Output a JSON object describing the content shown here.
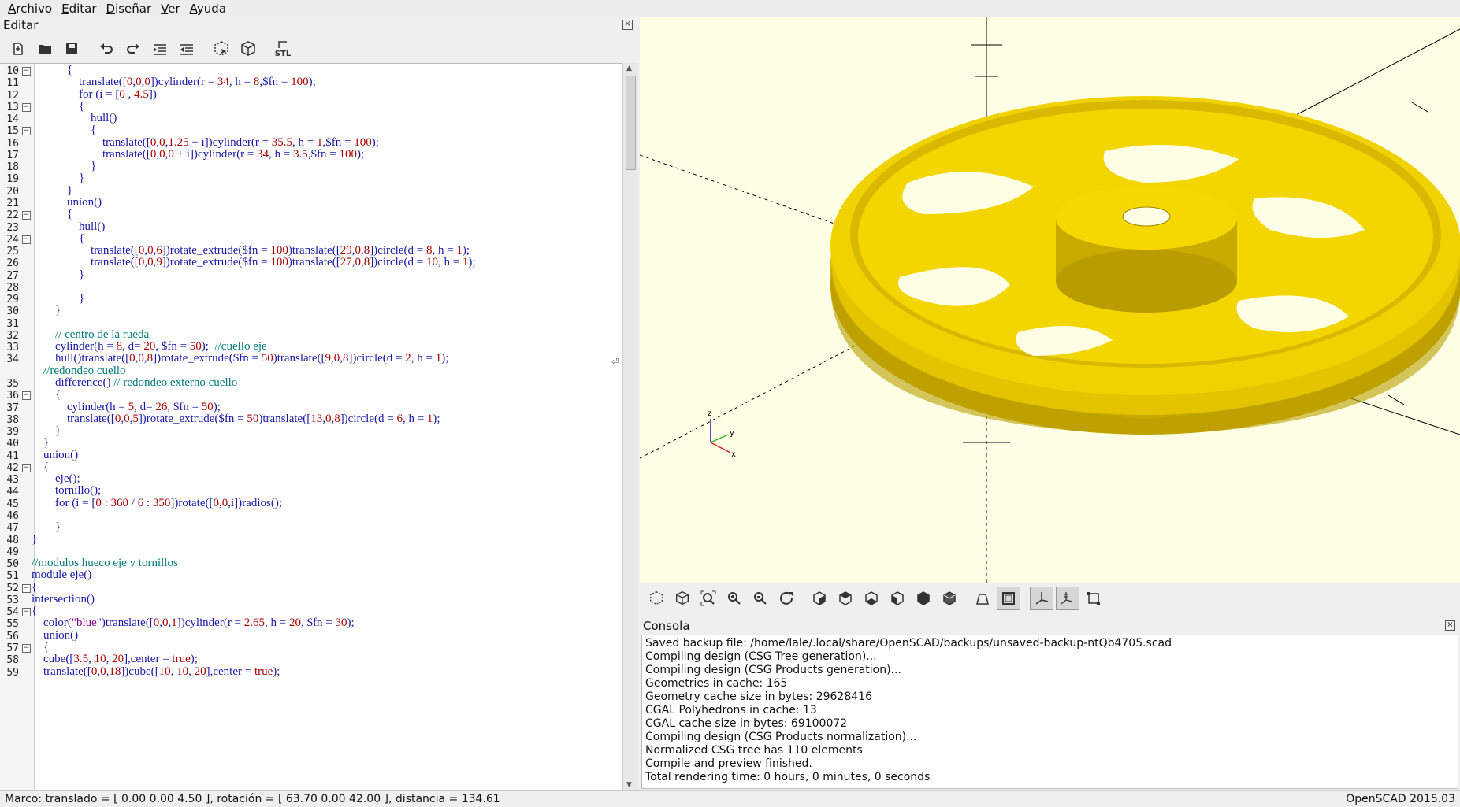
{
  "menu": [
    "Archivo",
    "Editar",
    "Diseñar",
    "Ver",
    "Ayuda"
  ],
  "editor": {
    "title": "Editar",
    "close": "×"
  },
  "editor_toolbar": [
    "new-file-icon",
    "open-file-icon",
    "save-icon",
    "undo-icon",
    "redo-icon",
    "indent-icon",
    "unindent-icon",
    "preview-icon",
    "render-icon",
    "export-stl-icon"
  ],
  "stl_label": "STL",
  "code": [
    {
      "n": "10",
      "f": true,
      "segs": [
        [
          "k",
          "            {"
        ]
      ]
    },
    {
      "n": "11",
      "f": false,
      "segs": [
        [
          "k",
          "                translate(["
        ],
        [
          "n",
          "0"
        ],
        [
          "k",
          ","
        ],
        [
          "n",
          "0"
        ],
        [
          "k",
          ","
        ],
        [
          "n",
          "0"
        ],
        [
          "k",
          "])cylinder(r = "
        ],
        [
          "n",
          "34"
        ],
        [
          "k",
          ", h = "
        ],
        [
          "n",
          "8"
        ],
        [
          "k",
          ",$fn = "
        ],
        [
          "n",
          "100"
        ],
        [
          "k",
          ");"
        ]
      ]
    },
    {
      "n": "12",
      "f": false,
      "segs": [
        [
          "k",
          "                for (i = ["
        ],
        [
          "n",
          "0"
        ],
        [
          "k",
          " , "
        ],
        [
          "n",
          "4.5"
        ],
        [
          "k",
          "])"
        ]
      ]
    },
    {
      "n": "13",
      "f": true,
      "segs": [
        [
          "k",
          "                {"
        ]
      ]
    },
    {
      "n": "14",
      "f": false,
      "segs": [
        [
          "k",
          "                    hull()"
        ]
      ]
    },
    {
      "n": "15",
      "f": true,
      "segs": [
        [
          "k",
          "                    {"
        ]
      ]
    },
    {
      "n": "16",
      "f": false,
      "segs": [
        [
          "k",
          "                        translate(["
        ],
        [
          "n",
          "0"
        ],
        [
          "k",
          ","
        ],
        [
          "n",
          "0"
        ],
        [
          "k",
          ","
        ],
        [
          "n",
          "1.25"
        ],
        [
          "k",
          " + i])cylinder(r = "
        ],
        [
          "n",
          "35.5"
        ],
        [
          "k",
          ", h = "
        ],
        [
          "n",
          "1"
        ],
        [
          "k",
          ",$fn = "
        ],
        [
          "n",
          "100"
        ],
        [
          "k",
          ");"
        ]
      ]
    },
    {
      "n": "17",
      "f": false,
      "segs": [
        [
          "k",
          "                        translate(["
        ],
        [
          "n",
          "0"
        ],
        [
          "k",
          ","
        ],
        [
          "n",
          "0"
        ],
        [
          "k",
          ","
        ],
        [
          "n",
          "0"
        ],
        [
          "k",
          " + i])cylinder(r = "
        ],
        [
          "n",
          "34"
        ],
        [
          "k",
          ", h = "
        ],
        [
          "n",
          "3.5"
        ],
        [
          "k",
          ",$fn = "
        ],
        [
          "n",
          "100"
        ],
        [
          "k",
          ");"
        ]
      ]
    },
    {
      "n": "18",
      "f": false,
      "segs": [
        [
          "k",
          "                    }"
        ]
      ]
    },
    {
      "n": "19",
      "f": false,
      "segs": [
        [
          "k",
          "                }"
        ]
      ]
    },
    {
      "n": "20",
      "f": false,
      "segs": [
        [
          "k",
          "            }"
        ]
      ]
    },
    {
      "n": "21",
      "f": false,
      "segs": [
        [
          "k",
          "            union()"
        ]
      ]
    },
    {
      "n": "22",
      "f": true,
      "segs": [
        [
          "k",
          "            {"
        ]
      ]
    },
    {
      "n": "23",
      "f": false,
      "segs": [
        [
          "k",
          "                hull()"
        ]
      ]
    },
    {
      "n": "24",
      "f": true,
      "segs": [
        [
          "k",
          "                {"
        ]
      ]
    },
    {
      "n": "25",
      "f": false,
      "segs": [
        [
          "k",
          "                    translate(["
        ],
        [
          "n",
          "0"
        ],
        [
          "k",
          ","
        ],
        [
          "n",
          "0"
        ],
        [
          "k",
          ","
        ],
        [
          "n",
          "6"
        ],
        [
          "k",
          "])rotate_extrude($fn = "
        ],
        [
          "n",
          "100"
        ],
        [
          "k",
          ")translate(["
        ],
        [
          "n",
          "29"
        ],
        [
          "k",
          ","
        ],
        [
          "n",
          "0"
        ],
        [
          "k",
          ","
        ],
        [
          "n",
          "8"
        ],
        [
          "k",
          "])circle(d = "
        ],
        [
          "n",
          "8"
        ],
        [
          "k",
          ", h = "
        ],
        [
          "n",
          "1"
        ],
        [
          "k",
          ");"
        ]
      ]
    },
    {
      "n": "26",
      "f": false,
      "segs": [
        [
          "k",
          "                    translate(["
        ],
        [
          "n",
          "0"
        ],
        [
          "k",
          ","
        ],
        [
          "n",
          "0"
        ],
        [
          "k",
          ","
        ],
        [
          "n",
          "9"
        ],
        [
          "k",
          "])rotate_extrude($fn = "
        ],
        [
          "n",
          "100"
        ],
        [
          "k",
          ")translate(["
        ],
        [
          "n",
          "27"
        ],
        [
          "k",
          ","
        ],
        [
          "n",
          "0"
        ],
        [
          "k",
          ","
        ],
        [
          "n",
          "8"
        ],
        [
          "k",
          "])circle(d = "
        ],
        [
          "n",
          "10"
        ],
        [
          "k",
          ", h = "
        ],
        [
          "n",
          "1"
        ],
        [
          "k",
          ");"
        ]
      ]
    },
    {
      "n": "27",
      "f": false,
      "segs": [
        [
          "k",
          "                }"
        ]
      ]
    },
    {
      "n": "28",
      "f": false,
      "segs": [
        [
          "k",
          ""
        ]
      ]
    },
    {
      "n": "29",
      "f": false,
      "segs": [
        [
          "k",
          "                }"
        ]
      ]
    },
    {
      "n": "30",
      "f": false,
      "segs": [
        [
          "k",
          "        }"
        ]
      ]
    },
    {
      "n": "31",
      "f": false,
      "segs": [
        [
          "k",
          ""
        ]
      ]
    },
    {
      "n": "32",
      "f": false,
      "segs": [
        [
          "c",
          "        // centro de la rueda"
        ]
      ]
    },
    {
      "n": "33",
      "f": false,
      "segs": [
        [
          "k",
          "        cylinder(h = "
        ],
        [
          "n",
          "8"
        ],
        [
          "k",
          ", d= "
        ],
        [
          "n",
          "20"
        ],
        [
          "k",
          ", $fn = "
        ],
        [
          "n",
          "50"
        ],
        [
          "k",
          ");  "
        ],
        [
          "c",
          "//cuello eje"
        ]
      ]
    },
    {
      "n": "34",
      "f": false,
      "segs": [
        [
          "k",
          "        hull()translate(["
        ],
        [
          "n",
          "0"
        ],
        [
          "k",
          ","
        ],
        [
          "n",
          "0"
        ],
        [
          "k",
          ","
        ],
        [
          "n",
          "8"
        ],
        [
          "k",
          "])rotate_extrude($fn = "
        ],
        [
          "n",
          "50"
        ],
        [
          "k",
          ")translate(["
        ],
        [
          "n",
          "9"
        ],
        [
          "k",
          ","
        ],
        [
          "n",
          "0"
        ],
        [
          "k",
          ","
        ],
        [
          "n",
          "8"
        ],
        [
          "k",
          "])circle(d = "
        ],
        [
          "n",
          "2"
        ],
        [
          "k",
          ", h = "
        ],
        [
          "n",
          "1"
        ],
        [
          "k",
          ");"
        ]
      ]
    },
    {
      "n": "",
      "f": false,
      "segs": [
        [
          "c",
          "    //redondeo cuello"
        ]
      ]
    },
    {
      "n": "35",
      "f": false,
      "segs": [
        [
          "k",
          "        difference() "
        ],
        [
          "c",
          "// redondeo externo cuello"
        ]
      ]
    },
    {
      "n": "36",
      "f": true,
      "segs": [
        [
          "k",
          "        {"
        ]
      ]
    },
    {
      "n": "37",
      "f": false,
      "segs": [
        [
          "k",
          "            cylinder(h = "
        ],
        [
          "n",
          "5"
        ],
        [
          "k",
          ", d= "
        ],
        [
          "n",
          "26"
        ],
        [
          "k",
          ", $fn = "
        ],
        [
          "n",
          "50"
        ],
        [
          "k",
          ");"
        ]
      ]
    },
    {
      "n": "38",
      "f": false,
      "segs": [
        [
          "k",
          "            translate(["
        ],
        [
          "n",
          "0"
        ],
        [
          "k",
          ","
        ],
        [
          "n",
          "0"
        ],
        [
          "k",
          ","
        ],
        [
          "n",
          "5"
        ],
        [
          "k",
          "])rotate_extrude($fn = "
        ],
        [
          "n",
          "50"
        ],
        [
          "k",
          ")translate(["
        ],
        [
          "n",
          "13"
        ],
        [
          "k",
          ","
        ],
        [
          "n",
          "0"
        ],
        [
          "k",
          ","
        ],
        [
          "n",
          "8"
        ],
        [
          "k",
          "])circle(d = "
        ],
        [
          "n",
          "6"
        ],
        [
          "k",
          ", h = "
        ],
        [
          "n",
          "1"
        ],
        [
          "k",
          ");"
        ]
      ]
    },
    {
      "n": "39",
      "f": false,
      "segs": [
        [
          "k",
          "        }"
        ]
      ]
    },
    {
      "n": "40",
      "f": false,
      "segs": [
        [
          "k",
          "    }"
        ]
      ]
    },
    {
      "n": "41",
      "f": false,
      "segs": [
        [
          "k",
          "    union()"
        ]
      ]
    },
    {
      "n": "42",
      "f": true,
      "segs": [
        [
          "k",
          "    {"
        ]
      ]
    },
    {
      "n": "43",
      "f": false,
      "segs": [
        [
          "k",
          "        eje();"
        ]
      ]
    },
    {
      "n": "44",
      "f": false,
      "segs": [
        [
          "k",
          "        tornillo();"
        ]
      ]
    },
    {
      "n": "45",
      "f": false,
      "segs": [
        [
          "k",
          "        for (i = ["
        ],
        [
          "n",
          "0"
        ],
        [
          "k",
          " : "
        ],
        [
          "n",
          "360"
        ],
        [
          "k",
          " / "
        ],
        [
          "n",
          "6"
        ],
        [
          "k",
          " : "
        ],
        [
          "n",
          "350"
        ],
        [
          "k",
          "])rotate(["
        ],
        [
          "n",
          "0"
        ],
        [
          "k",
          ","
        ],
        [
          "n",
          "0"
        ],
        [
          "k",
          ",i])radios();"
        ]
      ]
    },
    {
      "n": "46",
      "f": false,
      "segs": [
        [
          "k",
          ""
        ]
      ]
    },
    {
      "n": "47",
      "f": false,
      "segs": [
        [
          "k",
          "        }"
        ]
      ]
    },
    {
      "n": "48",
      "f": false,
      "segs": [
        [
          "k",
          "}"
        ]
      ]
    },
    {
      "n": "49",
      "f": false,
      "segs": [
        [
          "k",
          ""
        ]
      ]
    },
    {
      "n": "50",
      "f": false,
      "segs": [
        [
          "c",
          "//modulos hueco eje y tornillos"
        ]
      ]
    },
    {
      "n": "51",
      "f": false,
      "segs": [
        [
          "k",
          "module eje()"
        ]
      ]
    },
    {
      "n": "52",
      "f": true,
      "segs": [
        [
          "k",
          "{"
        ]
      ]
    },
    {
      "n": "53",
      "f": false,
      "segs": [
        [
          "k",
          "intersection()"
        ]
      ]
    },
    {
      "n": "54",
      "f": true,
      "segs": [
        [
          "k",
          "{"
        ]
      ]
    },
    {
      "n": "55",
      "f": false,
      "segs": [
        [
          "k",
          "    color("
        ],
        [
          "s",
          "\"blue\""
        ],
        [
          "k",
          ")translate(["
        ],
        [
          "n",
          "0"
        ],
        [
          "k",
          ","
        ],
        [
          "n",
          "0"
        ],
        [
          "k",
          ","
        ],
        [
          "n",
          "1"
        ],
        [
          "k",
          "])cylinder(r = "
        ],
        [
          "n",
          "2.65"
        ],
        [
          "k",
          ", h = "
        ],
        [
          "n",
          "20"
        ],
        [
          "k",
          ", $fn = "
        ],
        [
          "n",
          "30"
        ],
        [
          "k",
          ");"
        ]
      ]
    },
    {
      "n": "56",
      "f": false,
      "segs": [
        [
          "k",
          "    union()"
        ]
      ]
    },
    {
      "n": "57",
      "f": true,
      "segs": [
        [
          "k",
          "    {"
        ]
      ]
    },
    {
      "n": "58",
      "f": false,
      "segs": [
        [
          "k",
          "    cube(["
        ],
        [
          "n",
          "3.5"
        ],
        [
          "k",
          ", "
        ],
        [
          "n",
          "10"
        ],
        [
          "k",
          ", "
        ],
        [
          "n",
          "20"
        ],
        [
          "k",
          "],center = "
        ],
        [
          "n",
          "true"
        ],
        [
          "k",
          ");"
        ]
      ]
    },
    {
      "n": "59",
      "f": false,
      "segs": [
        [
          "k",
          "    translate(["
        ],
        [
          "n",
          "0"
        ],
        [
          "k",
          ","
        ],
        [
          "n",
          "0"
        ],
        [
          "k",
          ","
        ],
        [
          "n",
          "18"
        ],
        [
          "k",
          "])cube(["
        ],
        [
          "n",
          "10"
        ],
        [
          "k",
          ", "
        ],
        [
          "n",
          "10"
        ],
        [
          "k",
          ", "
        ],
        [
          "n",
          "20"
        ],
        [
          "k",
          "],center = "
        ],
        [
          "n",
          "true"
        ],
        [
          "k",
          ");"
        ]
      ]
    }
  ],
  "view_toolbar": [
    "preview-icon",
    "render-icon",
    "view-all-icon",
    "zoom-in-icon",
    "zoom-out-icon",
    "reset-view-icon",
    "view-right-icon",
    "view-top-icon",
    "view-bottom-icon",
    "view-left-icon",
    "view-front-icon",
    "view-back-icon",
    "perspective-icon",
    "orthogonal-icon",
    "axes-icon",
    "scale-markers-icon",
    "edges-icon"
  ],
  "console": {
    "title": "Consola",
    "lines": [
      "Saved backup file: /home/lale/.local/share/OpenSCAD/backups/unsaved-backup-ntQb4705.scad",
      "Compiling design (CSG Tree generation)...",
      "Compiling design (CSG Products generation)...",
      "Geometries in cache: 165",
      "Geometry cache size in bytes: 29628416",
      "CGAL Polyhedrons in cache: 13",
      "CGAL cache size in bytes: 69100072",
      "Compiling design (CSG Products normalization)...",
      "Normalized CSG tree has 110 elements",
      "Compile and preview finished.",
      "Total rendering time: 0 hours, 0 minutes, 0 seconds"
    ]
  },
  "axis_labels": {
    "x": "x",
    "y": "y",
    "z": "z"
  },
  "status": {
    "left": "Marco: translado = [ 0.00 0.00 4.50 ], rotación = [ 63.70 0.00 42.00 ], distancia = 134.61",
    "right": "OpenSCAD 2015.03"
  },
  "colors": {
    "model": "#f0d200",
    "viewport_bg": "#ffffe5"
  }
}
